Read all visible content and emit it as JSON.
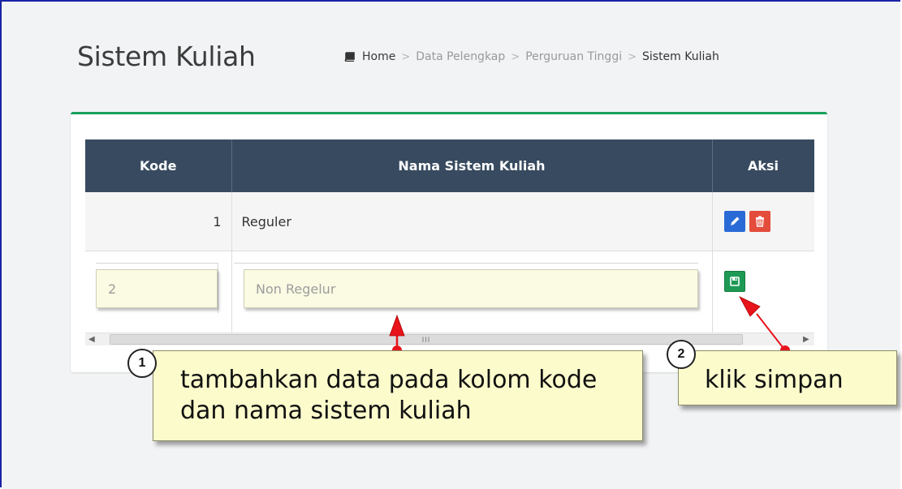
{
  "header": {
    "title": "Sistem Kuliah",
    "breadcrumb": {
      "home": "Home",
      "separator": ">",
      "items": [
        "Data Pelengkap",
        "Perguruan Tinggi"
      ],
      "current": "Sistem Kuliah"
    }
  },
  "table": {
    "columns": [
      "Kode",
      "Nama Sistem Kuliah",
      "Aksi"
    ],
    "rows": [
      {
        "kode": "1",
        "nama": "Reguler"
      }
    ],
    "new_row": {
      "kode_value": "2",
      "nama_value": "Non Regelur"
    },
    "scroll_grip": "III"
  },
  "annotations": [
    {
      "number": "1",
      "text": "tambahkan data pada kolom kode dan nama sistem kuliah"
    },
    {
      "number": "2",
      "text": "klik simpan"
    }
  ],
  "colors": {
    "header_bg": "#374a5f",
    "box_accent": "#19a05c",
    "edit_btn": "#2a6ad6",
    "delete_btn": "#e44c3c",
    "save_btn": "#1e9a55",
    "callout_bg": "#fbfbcc",
    "arrow": "#e8141c"
  },
  "icons": {
    "breadcrumb_home": "book-icon",
    "edit": "pencil-icon",
    "delete": "trash-icon",
    "save": "floppy-disk-icon"
  }
}
